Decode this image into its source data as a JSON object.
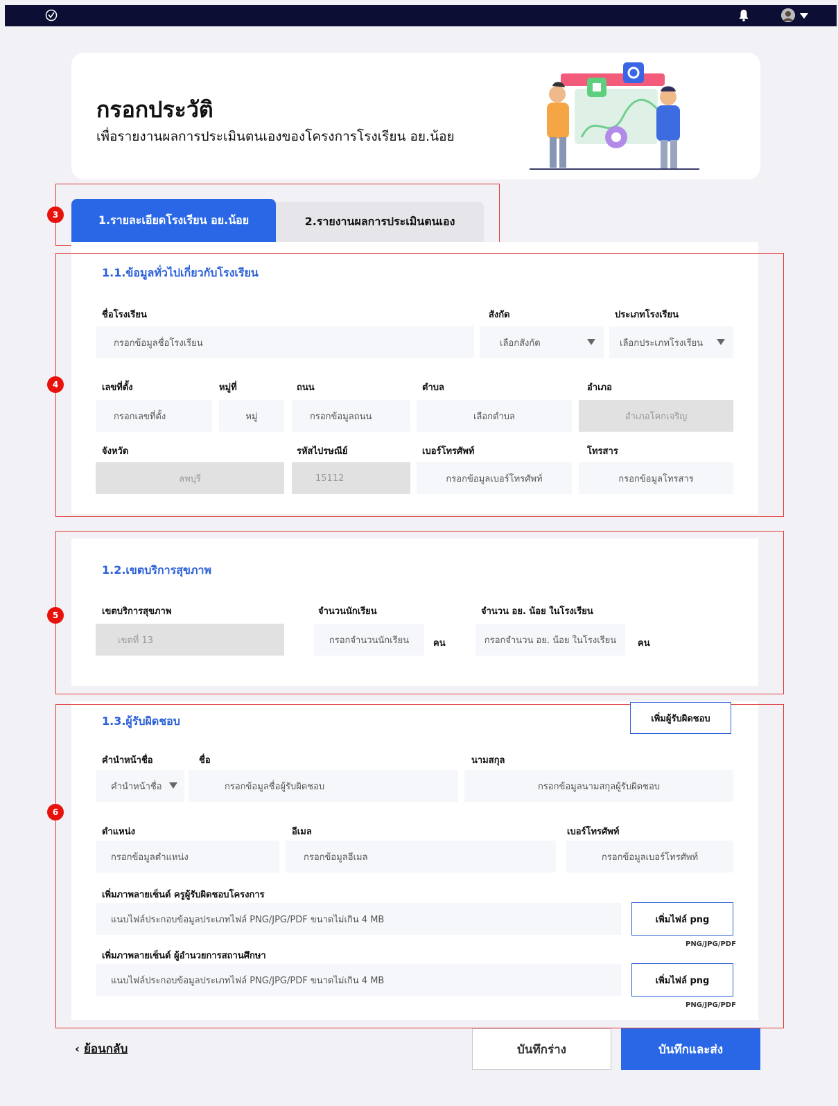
{
  "header": {
    "title": "กรอกประวัติ",
    "subtitle": "เพื่อรายงานผลการประเมินตนเองของโครงการโรงเรียน อย.น้อย"
  },
  "annotations": [
    "3",
    "4",
    "5",
    "6"
  ],
  "tabs": [
    {
      "label": "1.รายละเอียดโรงเรียน อย.น้อย",
      "active": true
    },
    {
      "label": "2.รายงานผลการประเมินตนเอง",
      "active": false
    }
  ],
  "general": {
    "title": "1.1.ข้อมูลทั่วไปเกี่ยวกับโรงเรียน",
    "school_name": {
      "label": "ชื่อโรงเรียน",
      "placeholder": "กรอกข้อมูลชื่อโรงเรียน"
    },
    "affiliation": {
      "label": "สังกัด",
      "value": "เลือกสังกัด"
    },
    "school_type": {
      "label": "ประเภทโรงเรียน",
      "value": "เลือกประเภทโรงเรียน"
    },
    "address_no": {
      "label": "เลขที่ตั้ง",
      "placeholder": "กรอกเลขที่ตั้ง"
    },
    "moo": {
      "label": "หมู่ที่",
      "placeholder": "หมู่"
    },
    "road": {
      "label": "ถนน",
      "placeholder": "กรอกข้อมูลถนน"
    },
    "subdistrict": {
      "label": "ตำบล",
      "value": "เลือกตำบล"
    },
    "district": {
      "label": "อำเภอ",
      "value": "อำเภอโคกเจริญ"
    },
    "province": {
      "label": "จังหวัด",
      "value": "ลพบุรี"
    },
    "postal": {
      "label": "รหัสไปรษณีย์",
      "value": "15112"
    },
    "phone": {
      "label": "เบอร์โทรศัพท์",
      "placeholder": "กรอกข้อมูลเบอร์โทรศัพท์"
    },
    "fax": {
      "label": "โทรสาร",
      "placeholder": "กรอกข้อมูลโทรสาร"
    }
  },
  "health": {
    "title": "1.2.เขตบริการสุขภาพ",
    "zone": {
      "label": "เขตบริการสุขภาพ",
      "value": "เขตที่ 13"
    },
    "students": {
      "label": "จำนวนนักเรียน",
      "placeholder": "กรอกจำนวนนักเรียน",
      "unit": "คน"
    },
    "ay_students": {
      "label": "จำนวน อย. น้อย ในโรงเรียน",
      "placeholder": "กรอกจำนวน อย. น้อย ในโรงเรียน",
      "unit": "คน"
    }
  },
  "responsible": {
    "title": "1.3.ผู้รับผิดชอบ",
    "add_button": "เพิ่มผู้รับผิดชอบ",
    "prefix": {
      "label": "คำนำหน้าชื่อ",
      "value": "คำนำหน้าชื่อ"
    },
    "first_name": {
      "label": "ชื่อ",
      "placeholder": "กรอกข้อมูลชื่อผู้รับผิดชอบ"
    },
    "last_name": {
      "label": "นามสกุล",
      "placeholder": "กรอกข้อมูลนามสกุลผู้รับผิดชอบ"
    },
    "position": {
      "label": "ตำแหน่ง",
      "placeholder": "กรอกข้อมูลตำแหน่ง"
    },
    "email": {
      "label": "อีเมล",
      "placeholder": "กรอกข้อมูลอีเมล"
    },
    "phone": {
      "label": "เบอร์โทรศัพท์",
      "placeholder": "กรอกข้อมูลเบอร์โทรศัพท์"
    },
    "sig_teacher": {
      "label": "เพิ่มภาพลายเซ็นต์ ครูผู้รับผิดชอบโครงการ",
      "placeholder": "แนบไฟล์ประกอบข้อมูลประเภทไฟล์ PNG/JPG/PDF ขนาดไม่เกิน 4 MB",
      "button": "เพิ่มไฟล์ png",
      "hint": "PNG/JPG/PDF"
    },
    "sig_director": {
      "label": "เพิ่มภาพลายเซ็นต์ ผู้อำนวยการสถานศึกษา",
      "placeholder": "แนบไฟล์ประกอบข้อมูลประเภทไฟล์ PNG/JPG/PDF ขนาดไม่เกิน 4 MB",
      "button": "เพิ่มไฟล์ png",
      "hint": "PNG/JPG/PDF"
    }
  },
  "footer": {
    "back": "ย้อนกลับ",
    "draft": "บันทึกร่าง",
    "submit": "บันทึกและส่ง"
  },
  "colors": {
    "primary": "#2967e6",
    "topbar": "#0c0f33",
    "annotation": "#e03a3a"
  }
}
